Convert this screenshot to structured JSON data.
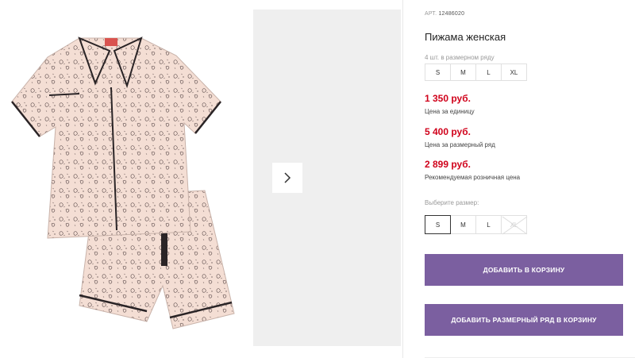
{
  "product": {
    "sku_label": "АРТ.",
    "sku": "12486020",
    "title": "Пижама женская"
  },
  "pack": {
    "label": "4 шт. в размерном ряду",
    "sizes": [
      "S",
      "M",
      "L",
      "XL"
    ]
  },
  "prices": {
    "unit_price": "1 350 руб.",
    "unit_note": "Цена за единицу",
    "pack_price": "5 400 руб.",
    "pack_note": "Цена за размерный ряд",
    "retail_price": "2 899 руб.",
    "retail_note": "Рекомендуемая розничная цена"
  },
  "size_select": {
    "label": "Выберите размер:",
    "options": [
      "S",
      "M",
      "L",
      "XL"
    ],
    "selected": "S",
    "unavailable": "XL"
  },
  "buttons": {
    "add_to_cart": "ДОБАВИТЬ В КОРЗИНУ",
    "add_pack_to_cart": "ДОБАВИТЬ РАЗМЕРНЫЙ РЯД В КОРЗИНУ"
  },
  "colors": {
    "price_red": "#d0021b",
    "button_purple": "#7b5fa0",
    "pajama_fabric": "#f3ddd3",
    "piping": "#2a2426"
  },
  "icons": {
    "gallery_next": "chevron-right-icon",
    "unavailable_size": "strike-through"
  }
}
